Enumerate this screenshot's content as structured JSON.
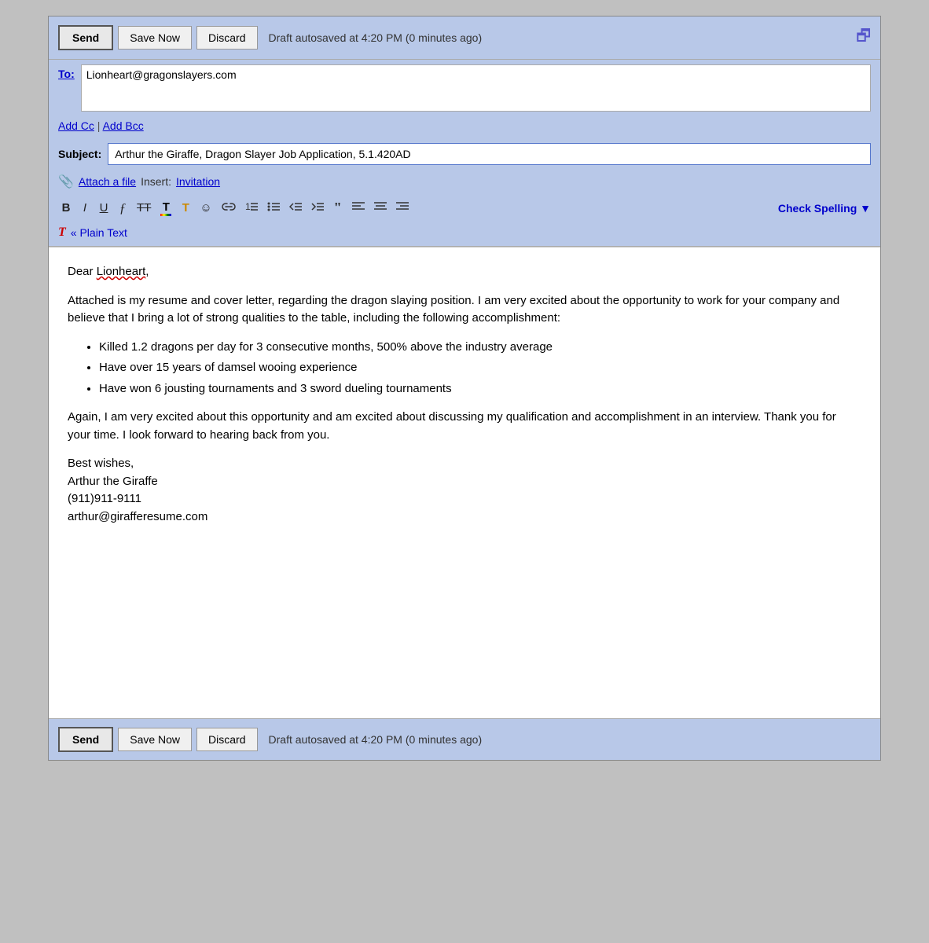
{
  "header": {
    "send_label": "Send",
    "save_label": "Save Now",
    "discard_label": "Discard",
    "autosave_text": "Draft autosaved at 4:20 PM (0 minutes ago)"
  },
  "to_field": {
    "label": "To:",
    "value": "Lionheart@gragonslayers.com"
  },
  "cc_bcc": {
    "add_cc": "Add Cc",
    "separator": " | ",
    "add_bcc": "Add Bcc"
  },
  "subject": {
    "label": "Subject:",
    "value": "Arthur the Giraffe, Dragon Slayer Job Application, 5.1.420AD"
  },
  "attach": {
    "paperclip": "📎",
    "attach_label": "Attach a file",
    "insert_label": "Insert:",
    "invitation_label": "Invitation"
  },
  "formatting": {
    "bold": "B",
    "italic": "I",
    "underline": "U",
    "script_f": "𝒻",
    "strikethrough": "TT̶",
    "color_text": "T",
    "highlight": "T̲",
    "emoji": "☺",
    "link": "🔗",
    "ordered_list": "≡",
    "unordered_list": "≡",
    "indent_less": "◁≡",
    "indent_more": "▷≡",
    "blockquote": "❝",
    "align_left": "≡",
    "align_center": "≡",
    "align_right": "≡",
    "check_spelling": "Check Spelling ▼"
  },
  "plain_text": {
    "icon": "T",
    "label": "« Plain Text"
  },
  "body": {
    "greeting": "Dear Lionheart,",
    "para1": "Attached is my resume and cover letter, regarding the dragon slaying position.  I am very excited about the opportunity to work for your company and believe that I bring a lot of strong qualities to the table, including the following accomplishment:",
    "bullets": [
      "Killed 1.2 dragons per day for 3 consecutive months, 500% above the industry average",
      "Have over 15 years of damsel wooing experience",
      "Have won 6 jousting tournaments and 3 sword dueling tournaments"
    ],
    "para2": "Again, I am very excited about this opportunity and am excited about discussing my qualification and accomplishment in an interview.  Thank you for your time.  I look forward to hearing back from you.",
    "sign_off": "Best wishes,",
    "name": "Arthur the Giraffe",
    "phone": "(911)911-9111",
    "email_sig": "arthur@girafferesume.com"
  },
  "footer": {
    "send_label": "Send",
    "save_label": "Save Now",
    "discard_label": "Discard",
    "autosave_text": "Draft autosaved at 4:20 PM (0 minutes ago)"
  }
}
